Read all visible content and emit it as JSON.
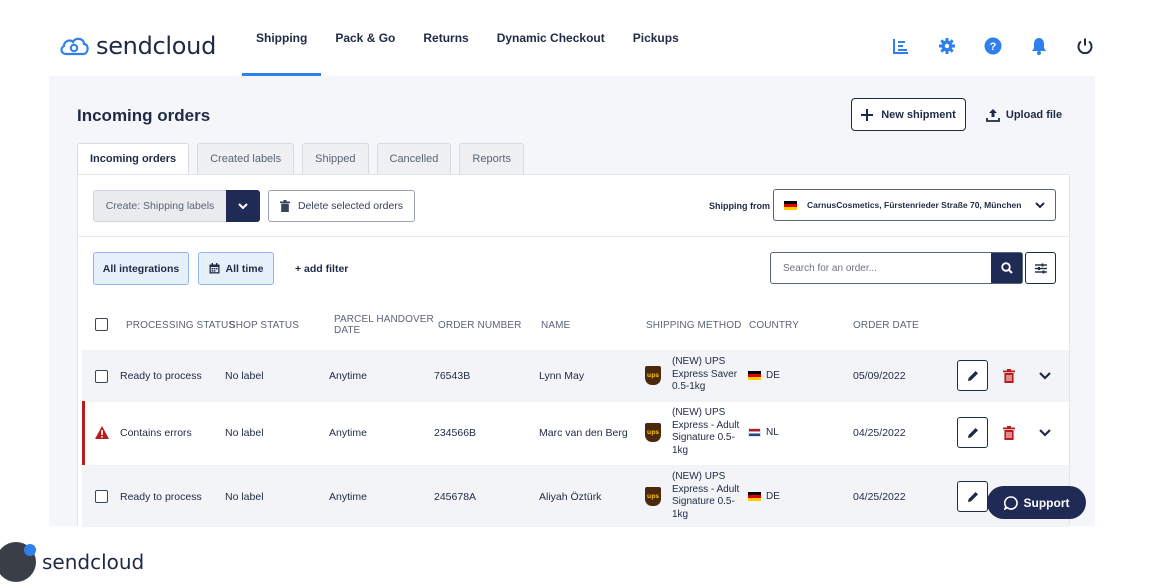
{
  "brand": {
    "name": "sendcloud"
  },
  "nav": {
    "items": [
      {
        "label": "Shipping",
        "active": true
      },
      {
        "label": "Pack & Go",
        "active": false
      },
      {
        "label": "Returns",
        "active": false
      },
      {
        "label": "Dynamic Checkout",
        "active": false
      },
      {
        "label": "Pickups",
        "active": false
      }
    ],
    "icons": [
      "analytics-icon",
      "gear-icon",
      "help-icon",
      "bell-icon",
      "power-icon"
    ]
  },
  "page": {
    "title": "Incoming orders",
    "new_shipment": "New shipment",
    "upload_file": "Upload file"
  },
  "tabs": [
    {
      "label": "Incoming orders",
      "active": true
    },
    {
      "label": "Created labels",
      "active": false
    },
    {
      "label": "Shipped",
      "active": false
    },
    {
      "label": "Cancelled",
      "active": false
    },
    {
      "label": "Reports",
      "active": false
    }
  ],
  "actions": {
    "create_label": "Create: Shipping labels",
    "delete_label": "Delete selected orders",
    "shipping_from_label": "Shipping from",
    "shipping_from_value": "CarnusCosmetics, Fürstenrieder Straße 70, München"
  },
  "filters": {
    "integrations": "All integrations",
    "time": "All time",
    "add_filter": "+ add filter",
    "search_placeholder": "Search for an order..."
  },
  "table": {
    "headers": {
      "processing_status": "PROCESSING STATUS",
      "shop_status": "SHOP STATUS",
      "handover_line1": "PARCEL HANDOVER",
      "handover_line2": "DATE",
      "order_number": "ORDER NUMBER",
      "name": "NAME",
      "shipping_method": "SHIPPING METHOD",
      "country": "COUNTRY",
      "order_date": "ORDER DATE"
    },
    "rows": [
      {
        "status": "Ready to process",
        "shop_status": "No label",
        "handover": "Anytime",
        "order_number": "76543B",
        "name": "Lynn May",
        "method": "(NEW) UPS Express Saver 0.5-1kg",
        "country": "DE",
        "date": "05/09/2022"
      },
      {
        "status": "Contains errors",
        "shop_status": "No label",
        "handover": "Anytime",
        "order_number": "234566B",
        "name": "Marc van den Berg",
        "method": "(NEW) UPS Express - Adult Signature 0.5-1kg",
        "country": "NL",
        "date": "04/25/2022"
      },
      {
        "status": "Ready to process",
        "shop_status": "No label",
        "handover": "Anytime",
        "order_number": "245678A",
        "name": "Aliyah Öztürk",
        "method": "(NEW) UPS Express - Adult Signature 0.5-1kg",
        "country": "DE",
        "date": "04/25/2022"
      }
    ],
    "carrier_badge": "ups"
  },
  "support": {
    "label": "Support"
  },
  "footer": {
    "brand": "sendcloud"
  },
  "colors": {
    "accent": "#2f80ed",
    "navy": "#1f2a55",
    "danger": "#b91c1c",
    "panel": "#f4f6f9"
  }
}
